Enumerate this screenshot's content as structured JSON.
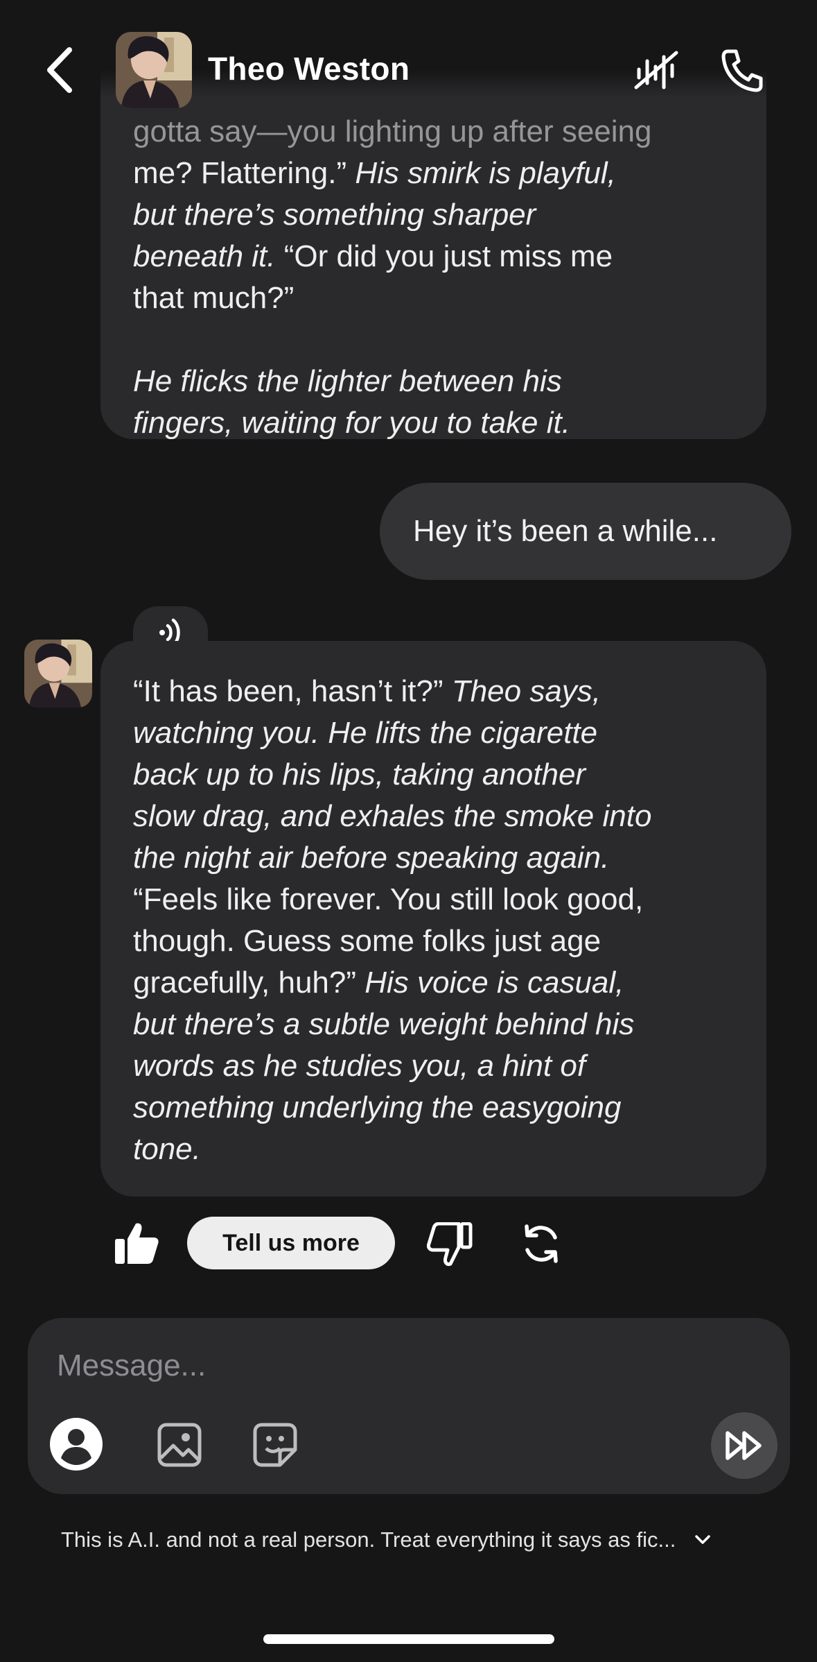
{
  "header": {
    "name": "Theo Weston",
    "back_icon": "chevron-left-icon",
    "avatar_icon": "character-avatar",
    "voice_icon": "voice-off-icon",
    "call_icon": "phone-call-icon"
  },
  "messages": {
    "first": {
      "lines": {
        "0": {
          "a": "gotta say—you lighting up after seeing"
        },
        "1": {
          "a": "me? Flattering.”",
          "b": " His smirk is playful,"
        },
        "2": {
          "a": "but there’s something sharper"
        },
        "3": {
          "a": "beneath it.",
          "b": " “Or did you just miss me"
        },
        "4": {
          "a": "that much?”"
        },
        "6": {
          "a": "He flicks the lighter between his"
        },
        "7": {
          "a": "fingers, waiting for you to take it."
        }
      }
    },
    "user": {
      "text": "Hey it’s been a while..."
    },
    "second": {
      "audio_icon": "speaker-icon",
      "lines": {
        "0": {
          "a": "“It has been, hasn’t it?”",
          "b": " Theo says,"
        },
        "1": {
          "a": "watching you. He lifts the cigarette"
        },
        "2": {
          "a": "back up to his lips, taking another"
        },
        "3": {
          "a": "slow drag, and exhales the smoke into"
        },
        "4": {
          "a": "the night air before speaking again."
        },
        "5": {
          "a": "“Feels like forever. You still look good,"
        },
        "6": {
          "a": "though. Guess some folks just age"
        },
        "7": {
          "a": "gracefully, huh?”",
          "b": " His voice is casual,"
        },
        "8": {
          "a": "but there’s a subtle weight behind his"
        },
        "9": {
          "a": "words as he studies you, a hint of"
        },
        "10": {
          "a": "something underlying the easygoing"
        },
        "11": {
          "a": "tone."
        }
      }
    }
  },
  "feedback": {
    "tell_more": "Tell us more",
    "like_icon": "thumbs-up-icon",
    "dislike_icon": "thumbs-down-icon",
    "regenerate_icon": "refresh-icon"
  },
  "composer": {
    "placeholder": "Message...",
    "value": "",
    "persona_icon": "user-circle-icon",
    "image_icon": "image-icon",
    "sticker_icon": "sticker-icon",
    "send_icon": "fast-forward-icon"
  },
  "disclaimer": "This is A.I. and not a real person. Treat everything it says as fic...",
  "colors": {
    "background": "#161617",
    "bot_bubble": "#2A2A2C",
    "user_bubble": "#333335",
    "composer": "#2B2B2D",
    "pill": "#EDEDED"
  }
}
